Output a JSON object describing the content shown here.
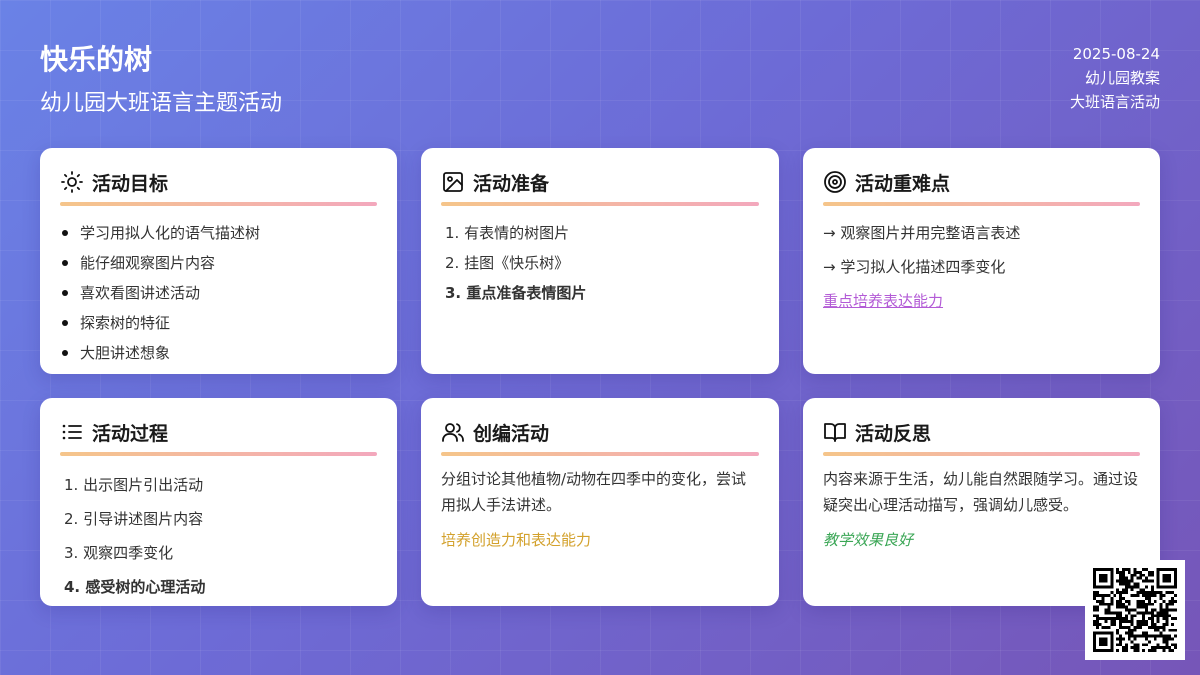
{
  "header": {
    "title": "快乐的树",
    "subtitle": "幼儿园大班语言主题活动",
    "date": "2025-08-24",
    "category": "幼儿园教案",
    "type": "大班语言活动"
  },
  "cards": {
    "goals": {
      "icon": "sun-icon",
      "title": "活动目标",
      "items": [
        "学习用拟人化的语气描述树",
        "能仔细观察图片内容",
        "喜欢看图讲述活动",
        "探索树的特征",
        "大胆讲述想象"
      ]
    },
    "prep": {
      "icon": "image-icon",
      "title": "活动准备",
      "items": [
        "1. 有表情的树图片",
        "2. 挂图《快乐树》",
        "3. 重点准备表情图片"
      ]
    },
    "focus": {
      "icon": "target-icon",
      "title": "活动重难点",
      "items": [
        "→ 观察图片并用完整语言表述",
        "→ 学习拟人化描述四季变化"
      ],
      "link": "重点培养表达能力"
    },
    "process": {
      "icon": "list-icon",
      "title": "活动过程",
      "items": [
        "1. 出示图片引出活动",
        "2. 引导讲述图片内容",
        "3. 观察四季变化",
        "4. 感受树的心理活动"
      ]
    },
    "create": {
      "icon": "users-icon",
      "title": "创编活动",
      "text": "分组讨论其他植物/动物在四季中的变化，尝试用拟人手法讲述。",
      "note": "培养创造力和表达能力"
    },
    "reflect": {
      "icon": "book-icon",
      "title": "活动反思",
      "text": "内容来源于生活，幼儿能自然跟随学习。通过设疑突出心理活动描写，强调幼儿感受。",
      "note": "教学效果良好"
    }
  },
  "qr": {
    "icon": "qr-code-icon"
  }
}
